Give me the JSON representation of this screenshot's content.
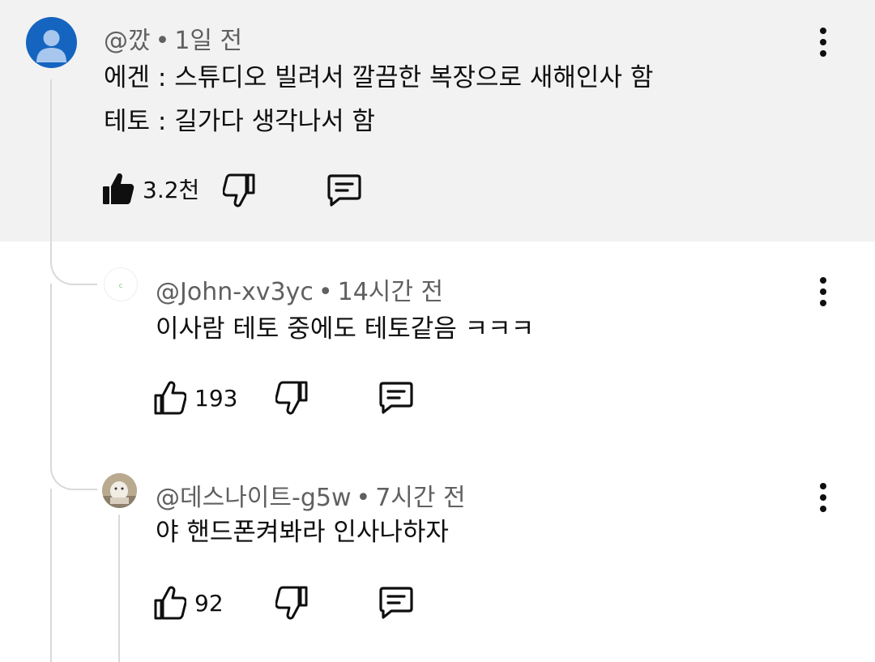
{
  "comments": [
    {
      "author": "@깠",
      "time": "1일 전",
      "lines": [
        "에겐 : 스튜디오 빌려서 깔끔한 복장으로 새해인사 함",
        "테토 : 길가다 생각나서 함"
      ],
      "likes": "3.2천",
      "liked": true,
      "highlighted": true
    },
    {
      "author": "@John-xv3yc",
      "time": "14시간 전",
      "lines": [
        "이사람 테토 중에도 테토같음 ㅋㅋㅋ"
      ],
      "likes": "193",
      "liked": false
    },
    {
      "author": "@데스나이트-g5w",
      "time": "7시간 전",
      "lines": [
        "야 핸드폰켜봐라 인사나하자"
      ],
      "likes": "92",
      "liked": false
    }
  ],
  "icons": {
    "like": "thumbs-up-icon",
    "dislike": "thumbs-down-icon",
    "reply": "reply-comment-icon",
    "more": "more-vertical-icon"
  },
  "colors": {
    "highlight_bg": "#f2f2f2",
    "avatar_blue": "#1565c0",
    "thread_line": "#d9d9d9",
    "text_secondary": "#606060"
  }
}
